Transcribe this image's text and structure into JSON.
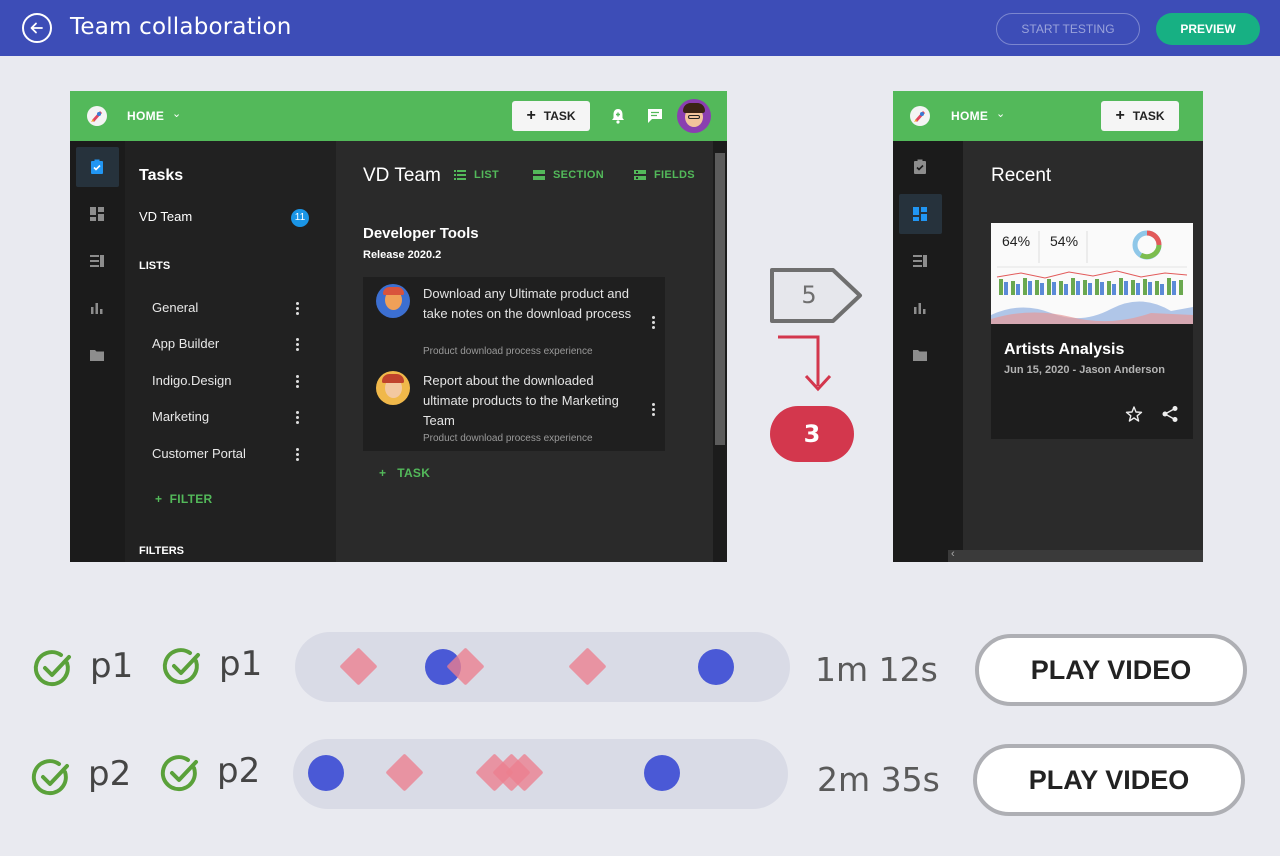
{
  "header": {
    "title": "Team collaboration",
    "start_testing": "START TESTING",
    "preview": "PREVIEW"
  },
  "screen1": {
    "home": "HOME",
    "task_button": "TASK",
    "sidebar_title": "Tasks",
    "team_name": "VD Team",
    "team_badge": "11",
    "lists_heading": "LISTS",
    "lists": [
      "General",
      "App Builder",
      "Indigo.Design",
      "Marketing",
      "Customer Portal"
    ],
    "filter": "FILTER",
    "filters_heading": "FILTERS",
    "content_title": "VD Team",
    "tabs": {
      "list": "LIST",
      "section": "SECTION",
      "fields": "FIELDS"
    },
    "group_title": "Developer Tools",
    "group_subtitle": "Release 2020.2",
    "tasks": [
      {
        "text": "Download any Ultimate product and take notes on the download process",
        "sub": "Product download process experience"
      },
      {
        "text": "Report about the downloaded ultimate products to the Marketing Team",
        "sub": "Product download process experience"
      }
    ],
    "add_task": "TASK"
  },
  "screen2": {
    "home": "HOME",
    "task_button": "TASK",
    "recent_title": "Recent",
    "card": {
      "name": "Artists Analysis",
      "sub": "Jun 15, 2020 - Jason Anderson",
      "kpi1": "64%",
      "kpi2": "54%"
    }
  },
  "flow": {
    "step_count": "5",
    "error_count": "3"
  },
  "rows": [
    {
      "label1": "p1",
      "label2": "p1",
      "duration": "1m 12s",
      "play": "PLAY VIDEO"
    },
    {
      "label1": "p2",
      "label2": "p2",
      "duration": "2m 35s",
      "play": "PLAY VIDEO"
    }
  ],
  "colors": {
    "header": "#3d4db7",
    "accent_green": "#53b95a",
    "preview": "#17b083",
    "error": "#d3374d",
    "click_dot": "#4a59d6",
    "misclick": "#ec7f8e"
  },
  "icons": [
    "back-arrow-icon",
    "rocket-icon",
    "chevron-down-icon",
    "bell-icon",
    "chat-icon",
    "clipboard-icon",
    "dashboard-icon",
    "list-icon",
    "bar-chart-icon",
    "folder-icon",
    "star-icon",
    "share-icon",
    "check-circle-icon"
  ]
}
